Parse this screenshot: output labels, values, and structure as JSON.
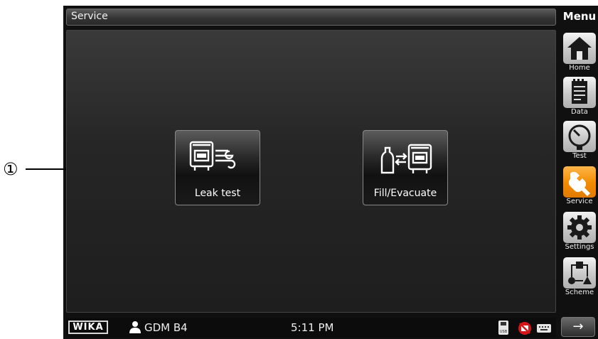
{
  "header": {
    "title": "Service",
    "menu_title": "Menu"
  },
  "tiles": [
    {
      "label": "Leak test",
      "icon": "leak-test-icon"
    },
    {
      "label": "Fill/Evacuate",
      "icon": "fill-evacuate-icon"
    }
  ],
  "sidebar": {
    "items": [
      {
        "label": "Home",
        "icon": "home-icon"
      },
      {
        "label": "Data",
        "icon": "data-icon"
      },
      {
        "label": "Test",
        "icon": "gauge-icon"
      },
      {
        "label": "Service",
        "icon": "wrench-icon",
        "active": true
      },
      {
        "label": "Settings",
        "icon": "gear-icon"
      },
      {
        "label": "Scheme",
        "icon": "scheme-icon"
      }
    ],
    "next_glyph": "→"
  },
  "statusbar": {
    "brand": "WIKA",
    "user": "GDM B4",
    "time": "5:11 PM",
    "usb_text": "USB"
  },
  "callout": {
    "number": "①"
  },
  "colors": {
    "accent": "#f28a00",
    "background": "#1e1e1e"
  }
}
